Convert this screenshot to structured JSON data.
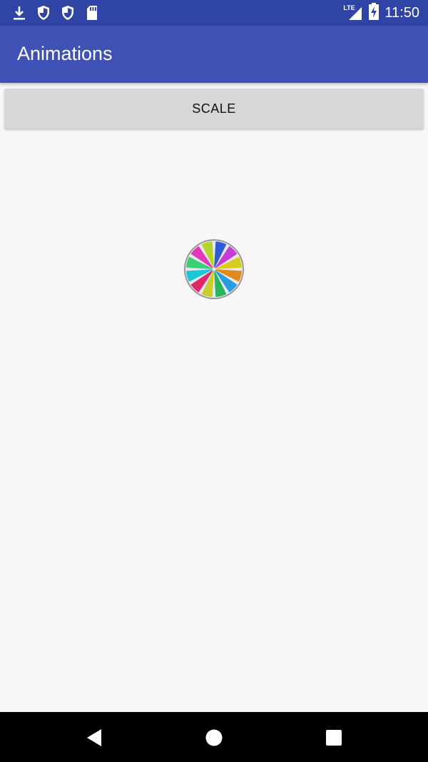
{
  "status_bar": {
    "time": "11:50",
    "network": "LTE",
    "left_icons": [
      "download-icon",
      "shield-icon",
      "shield-icon",
      "sd-card-icon"
    ],
    "right_icons": [
      "signal-icon",
      "battery-charging-icon"
    ],
    "background": "#2f44a4"
  },
  "app_bar": {
    "title": "Animations",
    "background": "#3f51b5"
  },
  "main": {
    "scale_button_label": "SCALE",
    "wheel": {
      "icon": "color-wheel-icon",
      "segments": [
        "#2e5bd6",
        "#c93bd6",
        "#d8cc1f",
        "#e08a1c",
        "#2a9de0",
        "#27b65e",
        "#c9cf2a",
        "#e0276b",
        "#1cc7d8",
        "#3bcf76",
        "#e03ab8",
        "#b8d62a"
      ]
    }
  },
  "nav_bar": {
    "back": "back-icon",
    "home": "home-icon",
    "recents": "recents-icon"
  }
}
